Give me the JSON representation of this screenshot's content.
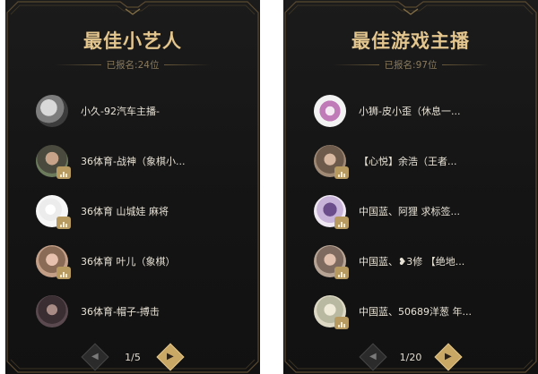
{
  "panels": [
    {
      "title": "最佳小艺人",
      "subtitle": "已报名:24位",
      "items": [
        {
          "name": "小久-92汽车主播-"
        },
        {
          "name": "36体育-战神（象棋小..."
        },
        {
          "name": "36体育 山城娃 麻将"
        },
        {
          "name": "36体育 叶儿（象棋）"
        },
        {
          "name": "36体育-帽子-搏击"
        }
      ],
      "pager": {
        "page_text": "1/5",
        "prev_icon": "◀",
        "next_icon": "▶"
      }
    },
    {
      "title": "最佳游戏主播",
      "subtitle": "已报名:97位",
      "items": [
        {
          "name": "小狮-皮小歪（休息一..."
        },
        {
          "name": "【心悦】余浩（王者..."
        },
        {
          "name": "中国蓝、阿狸 求标签..."
        },
        {
          "name": "中国蓝、❥3修 【绝地..."
        },
        {
          "name": "中国蓝、50689洋葱 年..."
        }
      ],
      "pager": {
        "page_text": "1/20",
        "prev_icon": "◀",
        "next_icon": "▶"
      }
    }
  ],
  "colors": {
    "gold": "#e3c58e",
    "panel_bg": "#161616",
    "badge": "#b79a60"
  }
}
